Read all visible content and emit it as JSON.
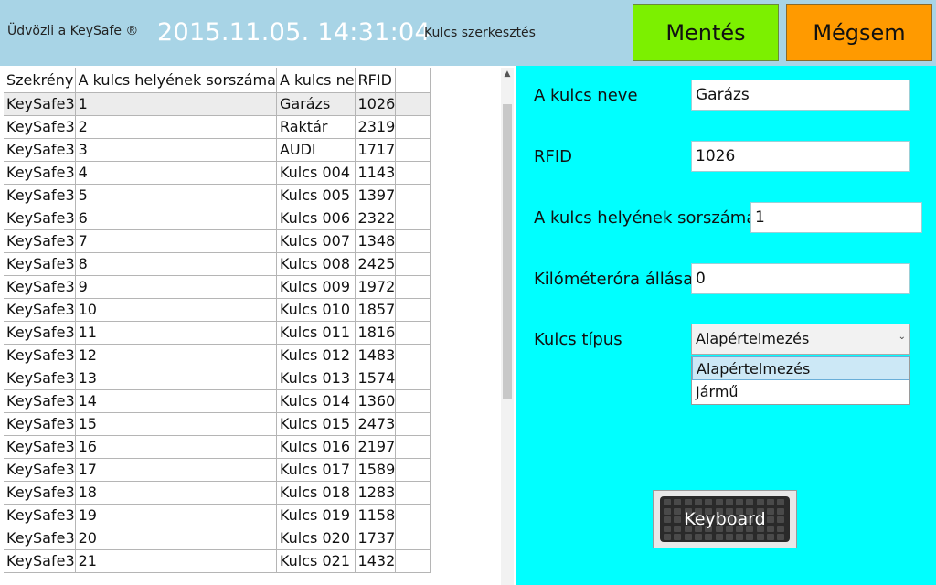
{
  "header": {
    "welcome": "Üdvözli a KeySafe ®",
    "datetime": "2015.11.05. 14:31:04",
    "screen_title": "Kulcs szerkesztés",
    "save_label": "Mentés",
    "cancel_label": "Mégsem"
  },
  "grid": {
    "columns": [
      "Szekrény",
      "A kulcs helyének sorszáma",
      "A kulcs ne",
      "RFID"
    ],
    "selected_row": 0,
    "rows": [
      [
        "KeySafe3",
        "1",
        "Garázs",
        "1026"
      ],
      [
        "KeySafe3",
        "2",
        "Raktár",
        "2319"
      ],
      [
        "KeySafe3",
        "3",
        "AUDI",
        "1717"
      ],
      [
        "KeySafe3",
        "4",
        "Kulcs 004",
        "1143"
      ],
      [
        "KeySafe3",
        "5",
        "Kulcs 005",
        "1397"
      ],
      [
        "KeySafe3",
        "6",
        "Kulcs 006",
        "2322"
      ],
      [
        "KeySafe3",
        "7",
        "Kulcs 007",
        "1348"
      ],
      [
        "KeySafe3",
        "8",
        "Kulcs 008",
        "2425"
      ],
      [
        "KeySafe3",
        "9",
        "Kulcs 009",
        "1972"
      ],
      [
        "KeySafe3",
        "10",
        "Kulcs 010",
        "1857"
      ],
      [
        "KeySafe3",
        "11",
        "Kulcs 011",
        "1816"
      ],
      [
        "KeySafe3",
        "12",
        "Kulcs 012",
        "1483"
      ],
      [
        "KeySafe3",
        "13",
        "Kulcs 013",
        "1574"
      ],
      [
        "KeySafe3",
        "14",
        "Kulcs 014",
        "1360"
      ],
      [
        "KeySafe3",
        "15",
        "Kulcs 015",
        "2473"
      ],
      [
        "KeySafe3",
        "16",
        "Kulcs 016",
        "2197"
      ],
      [
        "KeySafe3",
        "17",
        "Kulcs 017",
        "1589"
      ],
      [
        "KeySafe3",
        "18",
        "Kulcs 018",
        "1283"
      ],
      [
        "KeySafe3",
        "19",
        "Kulcs 019",
        "1158"
      ],
      [
        "KeySafe3",
        "20",
        "Kulcs 020",
        "1737"
      ],
      [
        "KeySafe3",
        "21",
        "Kulcs 021",
        "1432"
      ]
    ]
  },
  "form": {
    "name_label": "A kulcs neve",
    "name_value": "Garázs",
    "rfid_label": "RFID",
    "rfid_value": "1026",
    "position_label": "A kulcs helyének sorszáma",
    "position_value": "1",
    "odometer_label": "Kilóméteróra állása",
    "odometer_value": "0",
    "type_label": "Kulcs típus",
    "type_selected": "Alapértelmezés",
    "type_options": [
      "Alapértelmezés",
      "Jármű"
    ],
    "keyboard_label": "Keyboard"
  },
  "colors": {
    "header_bg": "#a8d4e6",
    "save_bg": "#7cf000",
    "cancel_bg": "#ff9a00",
    "panel_bg": "#00ffff"
  }
}
